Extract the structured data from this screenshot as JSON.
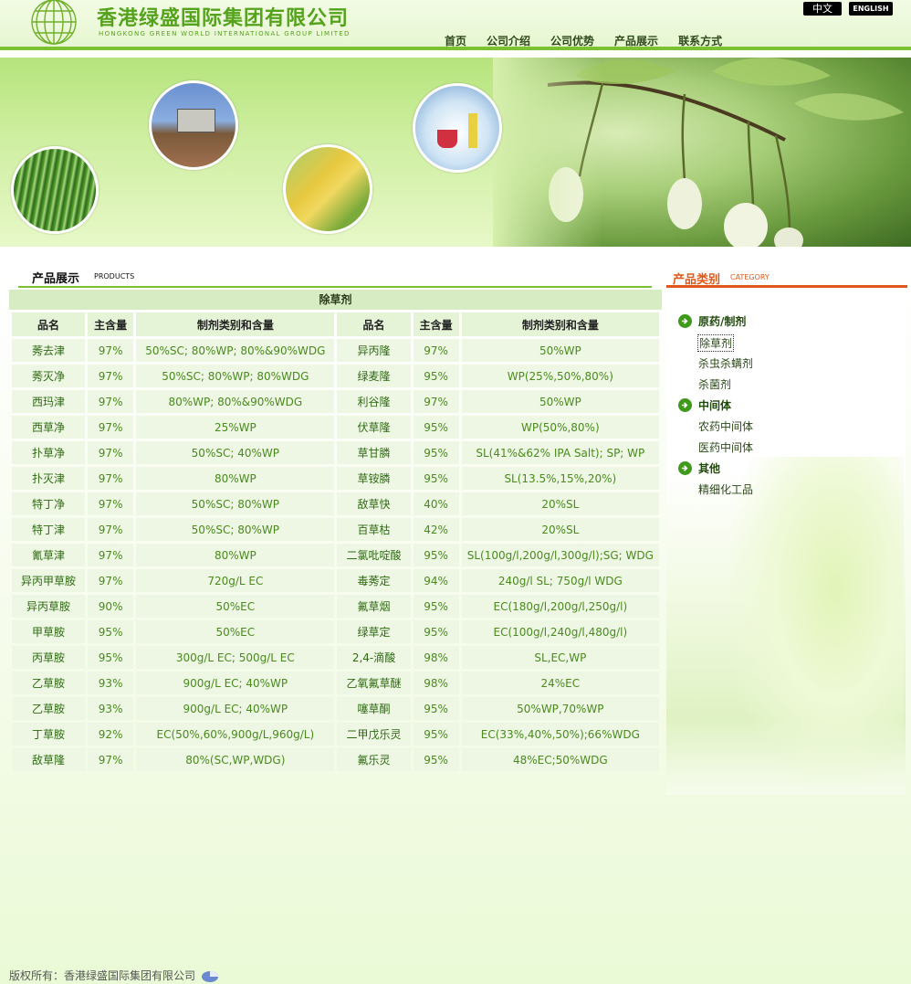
{
  "header": {
    "company_cn": "香港绿盛国际集团有限公司",
    "company_en": "HONGKONG GREEN WORLD INTERNATIONAL GROUP LIMITED",
    "lang_cn": "中文",
    "lang_en": "ENGLISH",
    "nav": [
      "首页",
      "公司介绍",
      "公司优势",
      "产品展示",
      "联系方式"
    ]
  },
  "main": {
    "section_title": "产品展示",
    "section_sub": "PRODUCTS",
    "table_caption": "除草剂",
    "columns": [
      "品名",
      "主含量",
      "制剂类别和含量",
      "品名",
      "主含量",
      "制剂类别和含量"
    ],
    "rows": [
      [
        "莠去津",
        "97%",
        "50%SC; 80%WP; 80%&90%WDG",
        "异丙隆",
        "97%",
        "50%WP"
      ],
      [
        "莠灭净",
        "97%",
        "50%SC; 80%WP; 80%WDG",
        "绿麦隆",
        "95%",
        "WP(25%,50%,80%)"
      ],
      [
        "西玛津",
        "97%",
        "80%WP; 80%&90%WDG",
        "利谷隆",
        "97%",
        "50%WP"
      ],
      [
        "西草净",
        "97%",
        "25%WP",
        "伏草隆",
        "95%",
        "WP(50%,80%)"
      ],
      [
        "扑草净",
        "97%",
        "50%SC; 40%WP",
        "草甘膦",
        "95%",
        "SL(41%&62% IPA Salt); SP; WP"
      ],
      [
        "扑灭津",
        "97%",
        "80%WP",
        "草铵膦",
        "95%",
        "SL(13.5%,15%,20%)"
      ],
      [
        "特丁净",
        "97%",
        "50%SC; 80%WP",
        "敌草快",
        "40%",
        "20%SL"
      ],
      [
        "特丁津",
        "97%",
        "50%SC; 80%WP",
        "百草枯",
        "42%",
        "20%SL"
      ],
      [
        "氰草津",
        "97%",
        "80%WP",
        "二氯吡啶酸",
        "95%",
        "SL(100g/l,200g/l,300g/l);SG; WDG"
      ],
      [
        "异丙甲草胺",
        "97%",
        "720g/L EC",
        "毒莠定",
        "94%",
        "240g/l SL; 750g/l WDG"
      ],
      [
        "异丙草胺",
        "90%",
        "50%EC",
        "氟草烟",
        "95%",
        "EC(180g/l,200g/l,250g/l)"
      ],
      [
        "甲草胺",
        "95%",
        "50%EC",
        "绿草定",
        "95%",
        "EC(100g/l,240g/l,480g/l)"
      ],
      [
        "丙草胺",
        "95%",
        "300g/L EC; 500g/L EC",
        "2,4-滴酸",
        "98%",
        "SL,EC,WP"
      ],
      [
        "乙草胺",
        "93%",
        "900g/L EC; 40%WP",
        "乙氧氟草醚",
        "98%",
        "24%EC"
      ],
      [
        "乙草胺",
        "93%",
        "900g/L EC; 40%WP",
        "噻草酮",
        "95%",
        "50%WP,70%WP"
      ],
      [
        "丁草胺",
        "92%",
        "EC(50%,60%,900g/L,960g/L)",
        "二甲戊乐灵",
        "95%",
        "EC(33%,40%,50%);66%WDG"
      ],
      [
        "敌草隆",
        "97%",
        "80%(SC,WP,WDG)",
        "氟乐灵",
        "95%",
        "48%EC;50%WDG"
      ]
    ]
  },
  "sidebar": {
    "title": "产品类别",
    "sub": "CATEGORY",
    "categories": [
      {
        "label": "原药/制剂",
        "items": [
          "除草剂",
          "杀虫杀螨剂",
          "杀菌剂"
        ]
      },
      {
        "label": "中间体",
        "items": [
          "农药中间体",
          "医药中间体"
        ]
      },
      {
        "label": "其他",
        "items": [
          "精细化工品"
        ]
      }
    ]
  },
  "footer": {
    "label": "版权所有：",
    "company": "香港绿盛国际集团有限公司"
  },
  "colors": {
    "brand_green": "#7cc12f",
    "accent_orange": "#e0591a",
    "cell_bg": "#edf7e3"
  }
}
